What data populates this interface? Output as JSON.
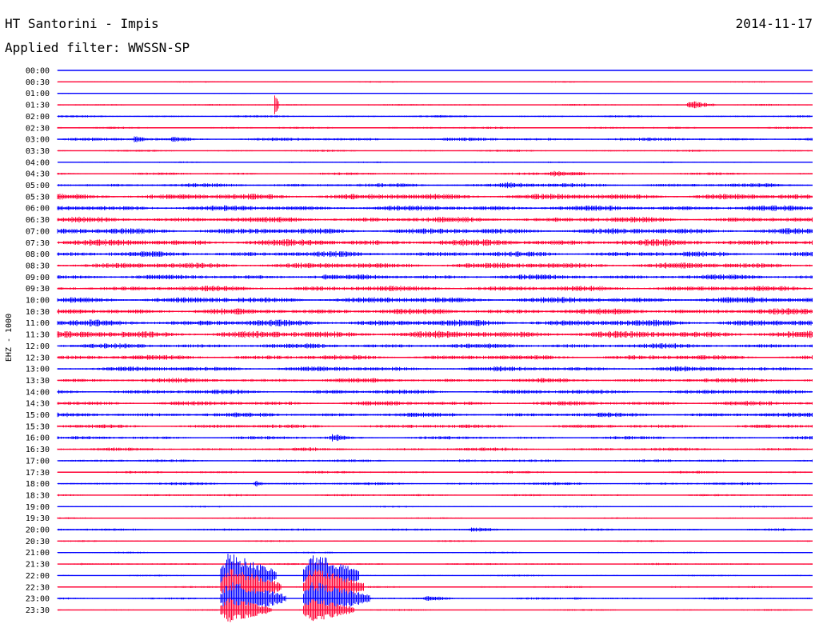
{
  "header": {
    "station": "HT Santorini - Impis",
    "date": "2014-11-17",
    "filter": "Applied filter: WWSSN-SP",
    "channel": "EHZ - 1000"
  },
  "colors": {
    "trace_a": "#0000ff",
    "trace_b": "#ff0033"
  },
  "chart_data": {
    "type": "line",
    "subtype": "helicorder",
    "trace_minutes": 30,
    "row_labels": [
      "00:00",
      "00:30",
      "01:00",
      "01:30",
      "02:00",
      "02:30",
      "03:00",
      "03:30",
      "04:00",
      "04:30",
      "05:00",
      "05:30",
      "06:00",
      "06:30",
      "07:00",
      "07:30",
      "08:00",
      "08:30",
      "09:00",
      "09:30",
      "10:00",
      "10:30",
      "11:00",
      "11:30",
      "12:00",
      "12:30",
      "13:00",
      "13:30",
      "14:00",
      "14:30",
      "15:00",
      "15:30",
      "16:00",
      "16:30",
      "17:00",
      "17:30",
      "18:00",
      "18:30",
      "19:00",
      "19:30",
      "20:00",
      "20:30",
      "21:00",
      "21:30",
      "22:00",
      "22:30",
      "23:00",
      "23:30"
    ],
    "noise_level": [
      0.3,
      0.5,
      0.3,
      0.6,
      0.8,
      0.8,
      1.2,
      0.7,
      0.6,
      0.9,
      1.4,
      2.2,
      2.0,
      2.0,
      2.2,
      2.4,
      2.0,
      2.2,
      1.8,
      2.0,
      2.2,
      2.2,
      2.4,
      2.6,
      1.8,
      1.8,
      1.8,
      1.6,
      1.6,
      1.6,
      1.6,
      1.4,
      1.2,
      1.2,
      1.0,
      0.9,
      1.0,
      0.8,
      0.6,
      0.6,
      0.9,
      0.6,
      0.6,
      0.7,
      0.6,
      0.7,
      0.8,
      0.6
    ],
    "events": [
      {
        "row": 3,
        "minute": 8.6,
        "amplitude": 14,
        "duration_min": 0.2
      },
      {
        "row": 3,
        "minute": 25.0,
        "amplitude": 5,
        "duration_min": 1.2
      },
      {
        "row": 6,
        "minute": 3.0,
        "amplitude": 5,
        "duration_min": 0.6
      },
      {
        "row": 6,
        "minute": 4.5,
        "amplitude": 4,
        "duration_min": 1.0
      },
      {
        "row": 9,
        "minute": 19.5,
        "amplitude": 4,
        "duration_min": 2.0
      },
      {
        "row": 10,
        "minute": 17.5,
        "amplitude": 4,
        "duration_min": 2.0
      },
      {
        "row": 18,
        "minute": 10.5,
        "amplitude": 4,
        "duration_min": 1.0
      },
      {
        "row": 32,
        "minute": 10.8,
        "amplitude": 5,
        "duration_min": 1.0
      },
      {
        "row": 36,
        "minute": 7.8,
        "amplitude": 4,
        "duration_min": 0.5
      },
      {
        "row": 40,
        "minute": 16.3,
        "amplitude": 3,
        "duration_min": 1.5
      },
      {
        "row": 43,
        "minute": 0.9,
        "amplitude": 2,
        "duration_min": 0.3
      },
      {
        "row": 44,
        "minute": 6.5,
        "amplitude": 30,
        "duration_min": 2.2
      },
      {
        "row": 44,
        "minute": 9.8,
        "amplitude": 30,
        "duration_min": 2.2
      },
      {
        "row": 45,
        "minute": 6.5,
        "amplitude": 26,
        "duration_min": 2.4
      },
      {
        "row": 45,
        "minute": 9.8,
        "amplitude": 26,
        "duration_min": 2.4
      },
      {
        "row": 46,
        "minute": 6.5,
        "amplitude": 22,
        "duration_min": 2.6
      },
      {
        "row": 46,
        "minute": 9.8,
        "amplitude": 22,
        "duration_min": 2.6
      },
      {
        "row": 46,
        "minute": 14.5,
        "amplitude": 4,
        "duration_min": 1.3
      },
      {
        "row": 46,
        "minute": 20.5,
        "amplitude": 2,
        "duration_min": 0.8
      },
      {
        "row": 47,
        "minute": 6.5,
        "amplitude": 16,
        "duration_min": 2.0
      },
      {
        "row": 47,
        "minute": 9.8,
        "amplitude": 16,
        "duration_min": 2.0
      }
    ]
  }
}
